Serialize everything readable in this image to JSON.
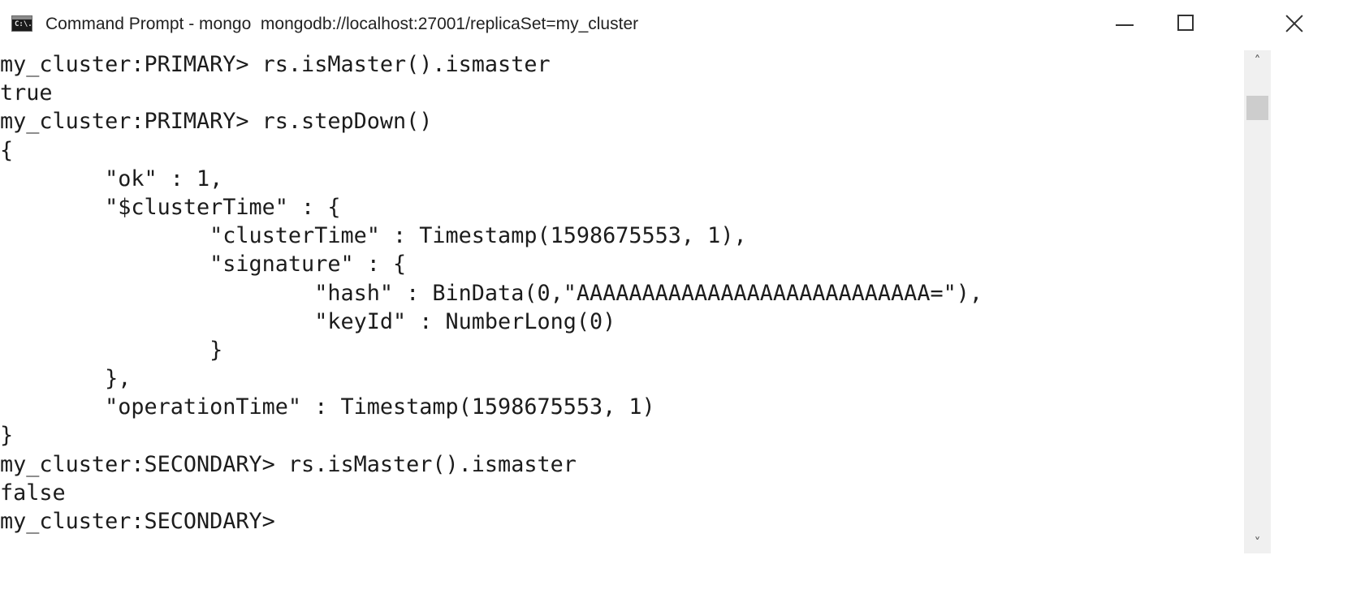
{
  "window": {
    "title": "Command Prompt - mongo  mongodb://localhost:27001/replicaSet=my_cluster",
    "icon": "cmd-icon",
    "icon_glyph": "C:\\."
  },
  "controls": {
    "minimize_icon": "minimize-icon",
    "maximize_icon": "maximize-icon",
    "close_icon": "close-icon"
  },
  "scrollbar": {
    "up_arrow": "˄",
    "down_arrow": "˅"
  },
  "console": {
    "lines": [
      "my_cluster:PRIMARY> rs.isMaster().ismaster",
      "true",
      "my_cluster:PRIMARY> rs.stepDown()",
      "{",
      "        \"ok\" : 1,",
      "        \"$clusterTime\" : {",
      "                \"clusterTime\" : Timestamp(1598675553, 1),",
      "                \"signature\" : {",
      "                        \"hash\" : BinData(0,\"AAAAAAAAAAAAAAAAAAAAAAAAAAA=\"),",
      "                        \"keyId\" : NumberLong(0)",
      "                }",
      "        },",
      "        \"operationTime\" : Timestamp(1598675553, 1)",
      "}",
      "my_cluster:SECONDARY> rs.isMaster().ismaster",
      "false",
      "my_cluster:SECONDARY>"
    ]
  }
}
